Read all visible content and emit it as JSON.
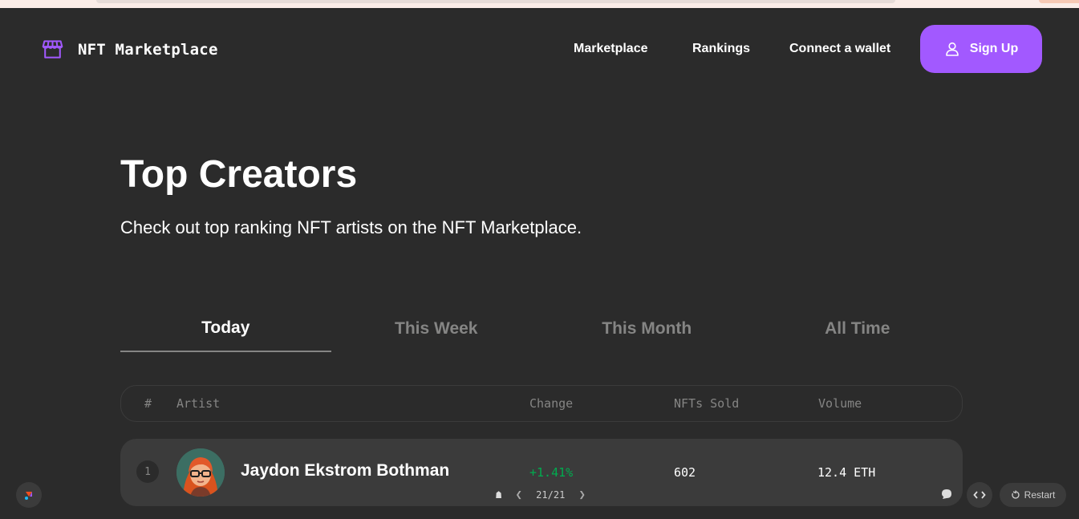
{
  "colors": {
    "background": "#2B2B2B",
    "accent": "#A259FF",
    "row_bg": "#3B3B3B",
    "muted": "#858584",
    "positive": "#00AC4F"
  },
  "brand": {
    "name": "NFT Marketplace",
    "icon": "storefront-icon"
  },
  "nav": {
    "links": [
      "Marketplace",
      "Rankings",
      "Connect a wallet"
    ],
    "signup_label": "Sign Up",
    "signup_icon": "user-icon"
  },
  "hero": {
    "title": "Top Creators",
    "subtitle": "Check out top ranking NFT artists on the NFT Marketplace."
  },
  "tabs": [
    {
      "label": "Today",
      "active": true
    },
    {
      "label": "This Week",
      "active": false
    },
    {
      "label": "This Month",
      "active": false
    },
    {
      "label": "All Time",
      "active": false
    }
  ],
  "table": {
    "headers": {
      "rank": "#",
      "artist": "Artist",
      "change": "Change",
      "sold": "NFTs Sold",
      "volume": "Volume"
    },
    "rows": [
      {
        "rank": "1",
        "artist": "Jaydon Ekstrom Bothman",
        "change": "+1.41%",
        "sold": "602",
        "volume": "12.4 ETH"
      }
    ]
  },
  "overlay": {
    "pager": "21/21",
    "restart_label": "Restart",
    "icons": [
      "home-icon",
      "chevron-left-icon",
      "chevron-right-icon",
      "chat-icon",
      "code-icon",
      "restart-icon",
      "app-logo-icon"
    ]
  }
}
